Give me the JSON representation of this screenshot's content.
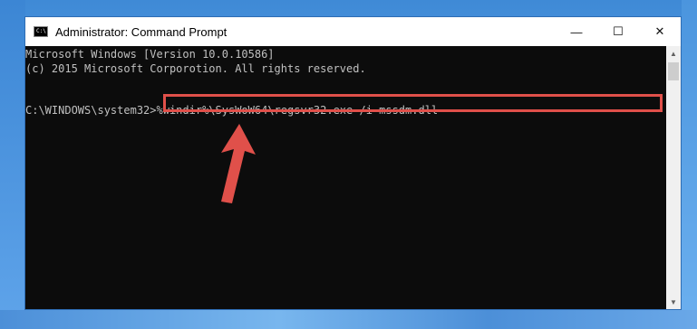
{
  "window": {
    "title": "Administrator: Command Prompt",
    "icon_label": "C:\\",
    "buttons": {
      "minimize": "—",
      "maximize": "☐",
      "close": "✕"
    }
  },
  "console": {
    "lines": [
      "Microsoft Windows [Version 10.0.10586]",
      "(c) 2015 Microsoft Corporotion. All rights reserved."
    ],
    "prompt": "C:\\WINDOWS\\system32>",
    "command": "%windir%\\SysWoW64\\regsvr32.exe /i mssdm.dll"
  },
  "annotations": {
    "highlight_color": "#e0504a",
    "arrow_color": "#e0504a"
  },
  "scrollbar": {
    "up_icon": "▲",
    "down_icon": "▼"
  }
}
